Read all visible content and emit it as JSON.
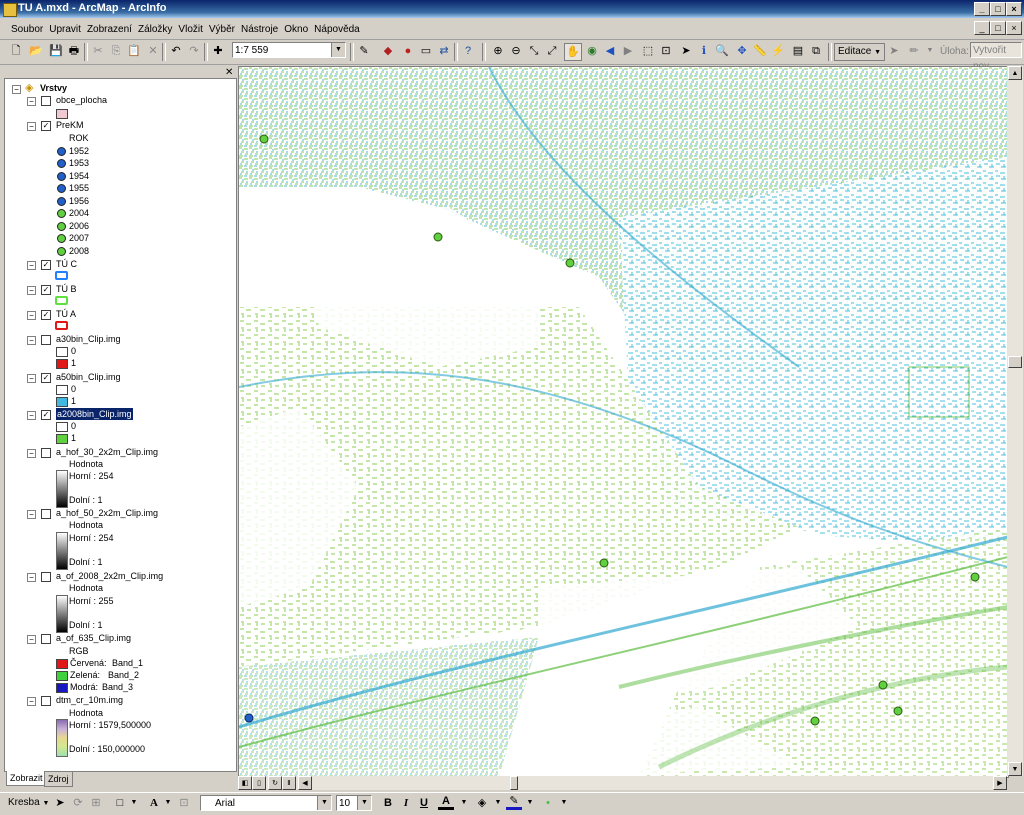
{
  "window": {
    "title": "TU A.mxd - ArcMap - ArcInfo"
  },
  "menu": [
    "Soubor",
    "Upravit",
    "Zobrazení",
    "Záložky",
    "Vložit",
    "Výběr",
    "Nástroje",
    "Okno",
    "Nápověda"
  ],
  "toolbar": {
    "scale": "1:7 559",
    "editor_label": "Editace",
    "task_label": "Úloha:",
    "task_value": "Vytvořit nov"
  },
  "toc": {
    "root_label": "Vrstvy",
    "layers": {
      "obce": "obce_plocha",
      "prekm": "PreKM",
      "prekm_field": "ROK",
      "years": [
        "1952",
        "1953",
        "1954",
        "1955",
        "1956",
        "2004",
        "2006",
        "2007",
        "2008"
      ],
      "tuc": "TÚ C",
      "tub": "TÚ B",
      "tua": "TÚ A",
      "a30": "a30bin_Clip.img",
      "a50": "a50bin_Clip.img",
      "a2008": "a2008bin_Clip.img",
      "hof30": "a_hof_30_2x2m_Clip.img",
      "hof50": "a_hof_50_2x2m_Clip.img",
      "of2008": "a_of_2008_2x2m_Clip.img",
      "of635": "a_of_635_Clip.img",
      "dtm": "dtm_cr_10m.img"
    },
    "bin": {
      "zero": "0",
      "one": "1"
    },
    "hodnota": "Hodnota",
    "hof30_hi": "Horní : 254",
    "hof30_lo": "Dolní : 1",
    "hof50_hi": "Horní : 254",
    "hof50_lo": "Dolní : 1",
    "of2008_hi": "Horní : 255",
    "of2008_lo": "Dolní : 1",
    "rgb": "RGB",
    "red": "Červená:",
    "red_band": "Band_1",
    "green": "Zelená:",
    "green_band": "Band_2",
    "blue": "Modrá:",
    "blue_band": "Band_3",
    "dtm_hi": "Horní : 1579,500000",
    "dtm_lo": "Dolní : 150,000000",
    "tabs": [
      "Zobrazit",
      "Zdroj"
    ]
  },
  "drawing": {
    "label": "Kresba",
    "font": "Arial",
    "size": "10",
    "bold": "B",
    "italic": "I",
    "underline": "U",
    "text_a": "A"
  },
  "colors": {
    "year_old": "#2060c8",
    "year_new": "#60d040",
    "tuc": "#2080ff",
    "tub": "#60e040",
    "tua": "#e01818",
    "a30_1": "#e01818",
    "a50_1": "#40b8e0",
    "a2008_1": "#60d040"
  }
}
